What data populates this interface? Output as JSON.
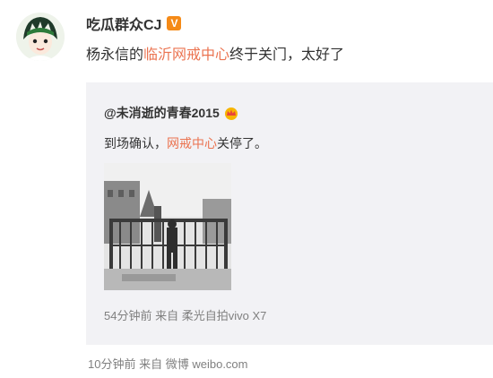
{
  "post": {
    "username": "吃瓜群众CJ",
    "verified_icon": "verified-badge-icon",
    "text_prefix": "杨永信的",
    "topic_link": "临沂网戒中心",
    "text_suffix": "终于关门，太好了",
    "meta": {
      "time": "10分钟前",
      "from_label": "来自",
      "source": "微博 weibo.com"
    }
  },
  "repost": {
    "username": "@未消逝的青春2015",
    "badge_icon": "crown-icon",
    "text_prefix": "到场确认，",
    "topic_link": "网戒中心",
    "text_suffix": "关停了。",
    "photo_icon": "photo-thumbnail",
    "meta": {
      "time": "54分钟前",
      "from_label": "来自",
      "source": "柔光自拍vivo X7"
    }
  },
  "colors": {
    "link": "#eb7350",
    "meta": "#808080",
    "repost_bg": "#f2f2f5",
    "badge": "#f58a17"
  }
}
